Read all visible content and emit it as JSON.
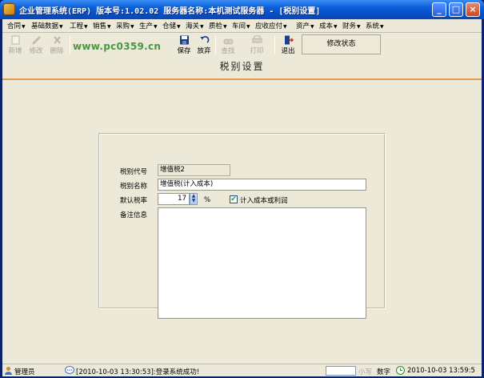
{
  "window": {
    "title": "企业管理系统(ERP) 版本号:1.02.02  服务器名称:本机测试服务器 - [税别设置]",
    "buttons": {
      "minimize": "_",
      "maximize": "□",
      "close": "×"
    }
  },
  "menu": {
    "items": [
      "合同",
      "基础数据",
      "工程",
      "销售",
      "采购",
      "生产",
      "仓储",
      "海关",
      "质检",
      "车间",
      "应收应付",
      "资产",
      "成本",
      "财务",
      "系统"
    ]
  },
  "toolbar": {
    "buttons": [
      {
        "label": "新增",
        "enabled": false
      },
      {
        "label": "修改",
        "enabled": false
      },
      {
        "label": "删除",
        "enabled": false
      },
      {
        "label": "保存",
        "enabled": true
      },
      {
        "label": "放弃",
        "enabled": true
      },
      {
        "label": "查找",
        "enabled": false
      },
      {
        "label": "打印",
        "enabled": false
      },
      {
        "label": "退出",
        "enabled": true
      }
    ],
    "status": "修改状态",
    "watermark": "www.pc0359.cn"
  },
  "page": {
    "title": "税别设置"
  },
  "form": {
    "code_label": "税别代号",
    "code_value": "增值税2",
    "name_label": "税别名称",
    "name_value": "增值税(计入成本)",
    "rate_label": "默认税率",
    "rate_value": "17",
    "rate_unit": "%",
    "cost_checkbox_label": "计入成本或利润",
    "cost_checkbox_checked": true,
    "remarks_label": "备注信息",
    "remarks_value": ""
  },
  "statusbar": {
    "user": "管理员",
    "message": "[2010-10-03 13:30:53]:登录系统成功!",
    "caps": "小写",
    "num": "数字",
    "clock": "2010-10-03 13:59:5"
  },
  "colors": {
    "accent_rule": "#e39a48",
    "title_bar": "#0a5fd8",
    "status_chip_border": "#e09850"
  }
}
